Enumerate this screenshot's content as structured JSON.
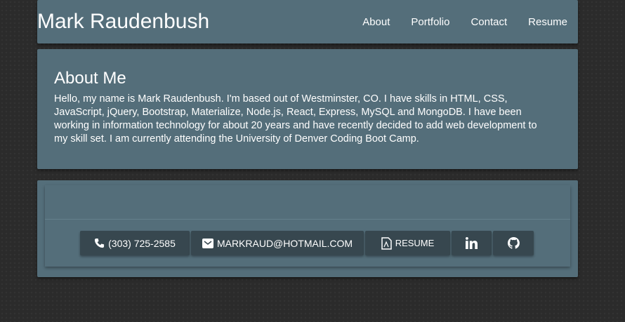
{
  "nav": {
    "brand": "Mark Raudenbush",
    "links": [
      "About",
      "Portfolio",
      "Contact",
      "Resume"
    ]
  },
  "about": {
    "title": "About Me",
    "text": "Hello, my name is Mark Raudenbush. I'm based out of Westminster, CO. I have skills in HTML, CSS, JavaScript, jQuery, Bootstrap, Materialize, Node.js, React, Express, MySQL and MongoDB. I have been working in information technology for about 20 years and have recently decided to add web development to my skill set. I am currently attending the University of Denver Coding Boot Camp."
  },
  "contact": {
    "phone": "(303) 725-2585",
    "email": "MARKRAUD@HOTMAIL.COM",
    "resume": "RESUME"
  }
}
